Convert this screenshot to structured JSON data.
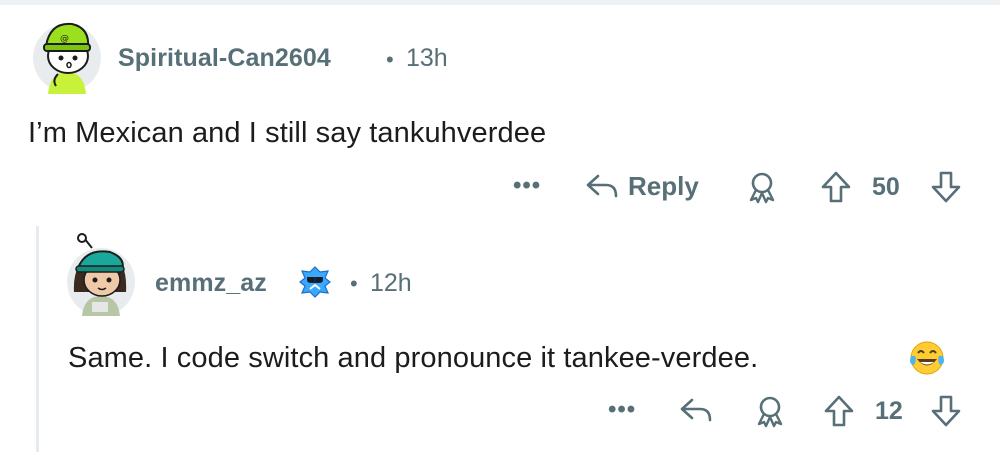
{
  "comment": {
    "username": "Spiritual-Can2604",
    "separator": "•",
    "time": "13h",
    "body": "I’m Mexican and I still say tankuhverdee",
    "actions": {
      "more": "•••",
      "reply_label": "Reply",
      "award_icon": "award-icon",
      "upvote_icon": "upvote-arrow-icon",
      "votes": "50",
      "downvote_icon": "downvote-arrow-icon"
    }
  },
  "reply": {
    "username": "emmz_az",
    "flair_icon": "achievement-badge-icon",
    "separator": "•",
    "time": "12h",
    "body": "Same. I code switch and pronounce it tankee-verdee.",
    "emoji": "face-with-tears-of-joy",
    "actions": {
      "more": "•••",
      "reply_icon": "reply-arrow-icon",
      "award_icon": "award-icon",
      "upvote_icon": "upvote-arrow-icon",
      "votes": "12",
      "downvote_icon": "downvote-arrow-icon"
    }
  },
  "colors": {
    "meta_text": "#576f76",
    "body_text": "#1c1c1c",
    "thread_line": "#e5ebee"
  }
}
